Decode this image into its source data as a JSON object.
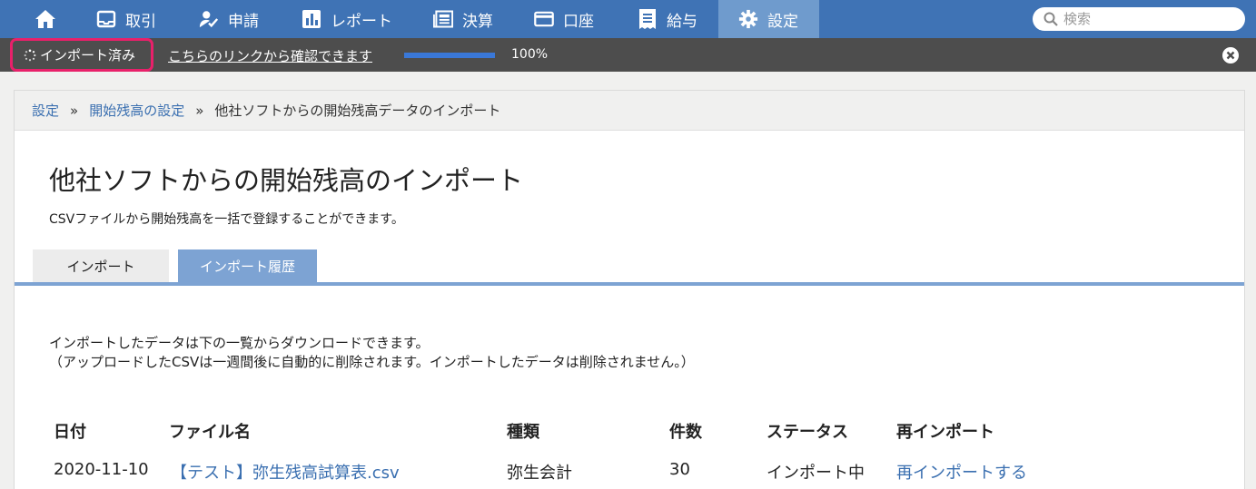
{
  "nav": {
    "items": [
      {
        "label": "取引",
        "icon": "transactions-icon"
      },
      {
        "label": "申請",
        "icon": "application-icon"
      },
      {
        "label": "レポート",
        "icon": "report-icon"
      },
      {
        "label": "決算",
        "icon": "closing-icon"
      },
      {
        "label": "口座",
        "icon": "account-icon"
      },
      {
        "label": "給与",
        "icon": "payroll-icon"
      },
      {
        "label": "設定",
        "icon": "gear-icon"
      }
    ],
    "active": "設定",
    "search_placeholder": "検索"
  },
  "importbar": {
    "badge": "インポート済み",
    "link": "こちらのリンクから確認できます",
    "progress_percent": 100,
    "progress_text": "100%"
  },
  "breadcrumb": {
    "items": [
      "設定",
      "開始残高の設定"
    ],
    "current": "他社ソフトからの開始残高データのインポート"
  },
  "page": {
    "title": "他社ソフトからの開始残高のインポート",
    "description": "CSVファイルから開始残高を一括で登録することができます。"
  },
  "tabs": {
    "import": "インポート",
    "history": "インポート履歴"
  },
  "note": {
    "line1": "インポートしたデータは下の一覧からダウンロードできます。",
    "line2": "（アップロードしたCSVは一週間後に自動的に削除されます。インポートしたデータは削除されません。）"
  },
  "table": {
    "headers": [
      "日付",
      "ファイル名",
      "種類",
      "件数",
      "ステータス",
      "再インポート"
    ],
    "rows": [
      [
        "2020-11-10",
        "【テスト】弥生残高試算表.csv",
        "弥生会計",
        "30",
        "インポート中",
        "再インポートする"
      ]
    ]
  },
  "colors": {
    "nav": "#3f73b5",
    "nav_active": "#6f9bcd",
    "importbar": "#4d4d4d",
    "highlight": "#e8206a",
    "link": "#3a6fb0",
    "tab_active": "#7da3d3"
  }
}
